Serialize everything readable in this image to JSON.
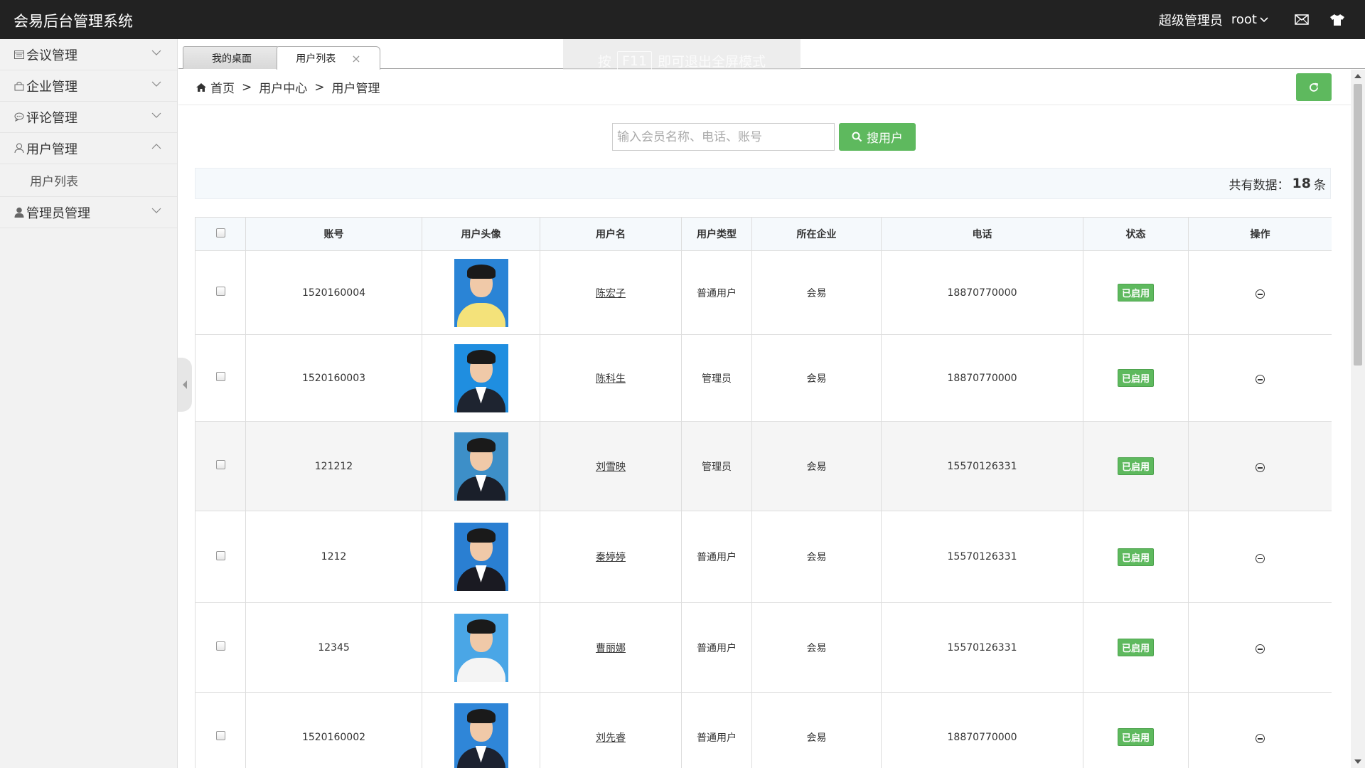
{
  "header": {
    "logo": "会易后台管理系统",
    "role": "超级管理员",
    "username": "root"
  },
  "sidebar": {
    "items": [
      {
        "label": "会议管理",
        "icon": "calendar-icon"
      },
      {
        "label": "企业管理",
        "icon": "bag-icon"
      },
      {
        "label": "评论管理",
        "icon": "comment-icon"
      },
      {
        "label": "用户管理",
        "icon": "user-outline-icon",
        "expanded": true
      },
      {
        "label": "管理员管理",
        "icon": "user-solid-icon"
      }
    ],
    "subitems": [
      "用户列表"
    ]
  },
  "tabs": {
    "home": "我的桌面",
    "active": "用户列表",
    "close": "×"
  },
  "f11_tip": {
    "before": "按",
    "key": "F11",
    "after": "即可退出全屏模式"
  },
  "breadcrumb": {
    "home": "首页",
    "sep": ">",
    "level2": "用户中心",
    "level3": "用户管理"
  },
  "search": {
    "placeholder": "输入会员名称、电话、账号",
    "value": "",
    "button": "搜用户"
  },
  "count": {
    "prefix": "共有数据：",
    "value": "18",
    "suffix": "条"
  },
  "table": {
    "headers": [
      "账号",
      "用户头像",
      "用户名",
      "用户类型",
      "所在企业",
      "电话",
      "状态",
      "操作"
    ],
    "rows": [
      {
        "account": "1520160004",
        "name": "陈宏子",
        "type": "普通用户",
        "company": "会易",
        "phone": "18870770000",
        "status": "已启用"
      },
      {
        "account": "1520160003",
        "name": "陈科生",
        "type": "管理员",
        "company": "会易",
        "phone": "18870770000",
        "status": "已启用"
      },
      {
        "account": "121212",
        "name": "刘雪映",
        "type": "管理员",
        "company": "会易",
        "phone": "15570126331",
        "status": "已启用"
      },
      {
        "account": "1212",
        "name": "秦婷婷",
        "type": "普通用户",
        "company": "会易",
        "phone": "15570126331",
        "status": "已启用"
      },
      {
        "account": "12345",
        "name": "曹丽娜",
        "type": "普通用户",
        "company": "会易",
        "phone": "15570126331",
        "status": "已启用"
      },
      {
        "account": "1520160002",
        "name": "刘先睿",
        "type": "普通用户",
        "company": "会易",
        "phone": "18870770000",
        "status": "已启用"
      }
    ]
  },
  "colors": {
    "header_bg": "#222222",
    "accent_green": "#5eb95e",
    "sidebar_bg": "#f2f2f2"
  }
}
